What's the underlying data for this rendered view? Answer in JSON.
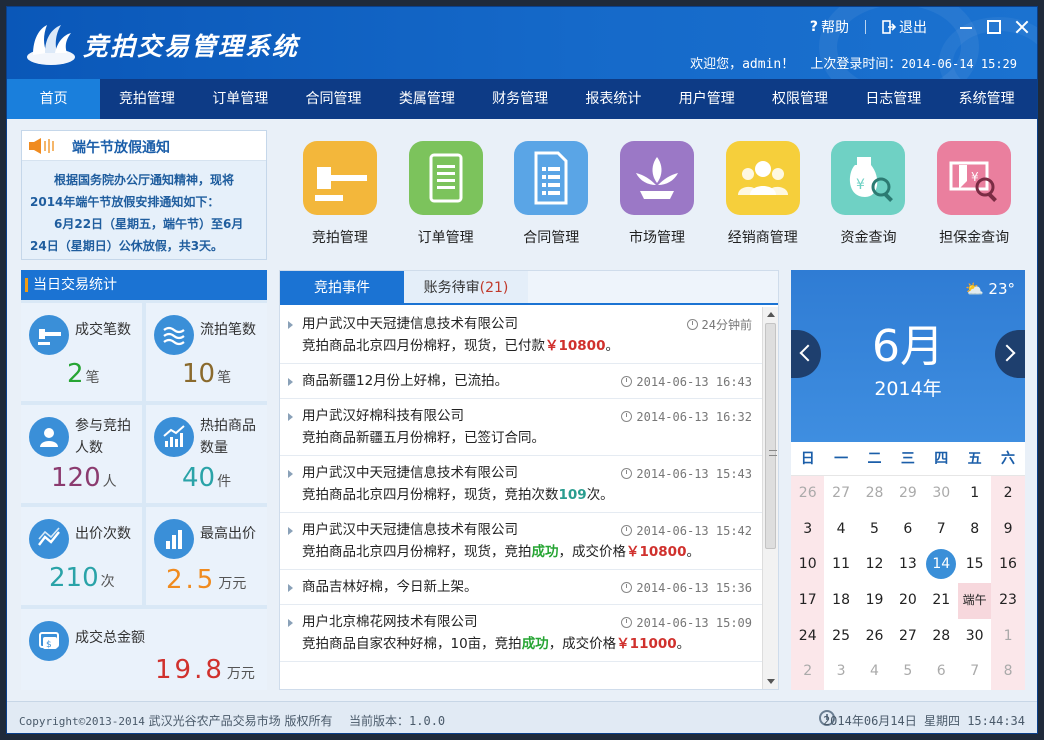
{
  "header": {
    "title": "竞拍交易管理系统",
    "help_label": "帮助",
    "logout_label": "退出",
    "welcome_prefix": "欢迎您，",
    "username": "admin！",
    "last_login_label": "上次登录时间：",
    "last_login_time": "2014-06-14 15:29"
  },
  "nav": {
    "items": [
      "首页",
      "竞拍管理",
      "订单管理",
      "合同管理",
      "类属管理",
      "财务管理",
      "报表统计",
      "用户管理",
      "权限管理",
      "日志管理",
      "系统管理"
    ],
    "active_index": 0
  },
  "notice": {
    "title": "端午节放假通知",
    "p1": "根据国务院办公厅通知精神，现将2014年端午节放假安排通知如下：",
    "p2": "6月22日（星期五，端午节）至6月24日（星期日）公休放假，共3天。"
  },
  "quick": [
    {
      "label": "竞拍管理",
      "color": "#f3b73b",
      "icon": "gavel-icon"
    },
    {
      "label": "订单管理",
      "color": "#7cc35c",
      "icon": "order-icon"
    },
    {
      "label": "合同管理",
      "color": "#5aa5e6",
      "icon": "contract-icon"
    },
    {
      "label": "市场管理",
      "color": "#9b78c6",
      "icon": "market-icon"
    },
    {
      "label": "经销商管理",
      "color": "#f6cf3b",
      "icon": "dealer-icon"
    },
    {
      "label": "资金查询",
      "color": "#6fd1c4",
      "icon": "money-search-icon"
    },
    {
      "label": "担保金查询",
      "color": "#ea7f9e",
      "icon": "deposit-search-icon"
    }
  ],
  "stats": {
    "title": "当日交易统计",
    "deals": {
      "name": "成交笔数",
      "value": "2",
      "unit": "笔"
    },
    "fails": {
      "name": "流拍笔数",
      "value": "10",
      "unit": "笔"
    },
    "bidders": {
      "name1": "参与竞拍",
      "name2": "人数",
      "value": "120",
      "unit": "人"
    },
    "hot": {
      "name1": "热拍商品",
      "name2": "数量",
      "value": "40",
      "unit": "件"
    },
    "bids": {
      "name": "出价次数",
      "value": "210",
      "unit": "次"
    },
    "highest": {
      "name": "最高出价",
      "value": "2.5",
      "unit": "万元"
    },
    "total": {
      "name": "成交总金额",
      "value": "19.8",
      "unit": "万元"
    }
  },
  "events": {
    "tab1": "竞拍事件",
    "tab2": "账务待审",
    "tab2_count": "(21)",
    "items": [
      {
        "l1": "用户武汉中天冠捷信息技术有限公司",
        "l2a": "竞拍商品北京四月份棉籽，现货，已付款",
        "l2b": "￥10800",
        "l2c": "。",
        "time": "24分钟前"
      },
      {
        "l1": "商品新疆12月份上好棉，已流拍。",
        "time": "2014-06-13 16:43"
      },
      {
        "l1": "用户武汉好棉科技有限公司",
        "l2a": "竞拍商品新疆五月份棉籽，已签订合同。",
        "time": "2014-06-13 16:32"
      },
      {
        "l1": "用户武汉中天冠捷信息技术有限公司",
        "l2a": "竞拍商品北京四月份棉籽，现货，竞拍次数",
        "l2b": "109",
        "l2c": "次。",
        "time": "2014-06-13 15:43"
      },
      {
        "l1": "用户武汉中天冠捷信息技术有限公司",
        "l2a": "竞拍商品北京四月份棉籽，现货，竞拍",
        "l2s": "成功",
        "l2d": "，成交价格",
        "l2b": "￥10800",
        "l2c": "。",
        "time": "2014-06-13 15:42"
      },
      {
        "l1": "商品吉林好棉，今日新上架。",
        "time": "2014-06-13 15:36"
      },
      {
        "l1": "用户北京棉花网技术有限公司",
        "l2a": "竞拍商品自家农种好棉，10亩，竞拍",
        "l2s": "成功",
        "l2d": "，成交价格",
        "l2b": "￥11000",
        "l2c": "。",
        "time": "2014-06-13 15:09"
      }
    ]
  },
  "calendar": {
    "temperature": "23°",
    "month": "6月",
    "year": "2014年",
    "weekdays": [
      "日",
      "一",
      "二",
      "三",
      "四",
      "五",
      "六"
    ],
    "rows": [
      [
        "26",
        "27",
        "28",
        "29",
        "30",
        "1",
        "2"
      ],
      [
        "3",
        "4",
        "5",
        "6",
        "7",
        "8",
        "9"
      ],
      [
        "10",
        "11",
        "12",
        "13",
        "14",
        "15",
        "16"
      ],
      [
        "17",
        "18",
        "19",
        "20",
        "21",
        "端午",
        "23"
      ],
      [
        "24",
        "25",
        "26",
        "27",
        "28",
        "30",
        "1"
      ],
      [
        "2",
        "3",
        "4",
        "5",
        "6",
        "7",
        "8"
      ]
    ],
    "today": "14"
  },
  "footer": {
    "copyright_prefix": "Copyright©2013-2014",
    "copyright_text": " 武汉光谷农产品交易市场 版权所有",
    "version_label": "当前版本：",
    "version": "1.0.0",
    "datetime": "2014年06月14日 星期四 15:44:34"
  }
}
